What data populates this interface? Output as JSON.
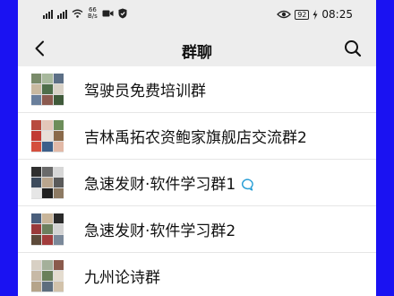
{
  "statusbar": {
    "left_text": "46",
    "speed": "66",
    "speed_unit": "B/s",
    "battery": "92",
    "time": "08:25"
  },
  "navbar": {
    "title": "群聊"
  },
  "groups": [
    {
      "name": "驾驶员免费培训群",
      "has_badge": false,
      "avatar_colors": [
        "#7a8b6a",
        "#a7b89c",
        "#5c6f86",
        "#c9b9a0",
        "#4e6e4a",
        "#d9d2c7",
        "#6a7f9b",
        "#8b5a4f",
        "#3f5a3a"
      ]
    },
    {
      "name": "吉林禹拓农资鲍家旗舰店交流群2",
      "has_badge": false,
      "avatar_colors": [
        "#b84b3f",
        "#e3c6b9",
        "#6d8d5a",
        "#c23a33",
        "#e8e0d8",
        "#8a6a4a",
        "#d44f3e",
        "#3c5f8a",
        "#e2b9a7"
      ]
    },
    {
      "name": "急速发财·软件学习群1",
      "has_badge": true,
      "avatar_colors": [
        "#2f2f2f",
        "#6a6a6a",
        "#d7d7d7",
        "#3d4b5c",
        "#b9a58e",
        "#5a5a5a",
        "#e6e6e6",
        "#1f1f1f",
        "#8d7a63"
      ]
    },
    {
      "name": "急速发财·软件学习群2",
      "has_badge": false,
      "avatar_colors": [
        "#4a5f7c",
        "#c8b59a",
        "#2a2a2a",
        "#9a3a3a",
        "#6c7f5e",
        "#d3d3d3",
        "#5d4a3a",
        "#a23c3c",
        "#7a8899"
      ]
    },
    {
      "name": "九州论诗群",
      "has_badge": false,
      "avatar_colors": [
        "#d8d0c4",
        "#a4b09a",
        "#8a5a4c",
        "#c7b9a6",
        "#6a7f5a",
        "#e4dccf",
        "#b5a48a",
        "#5e6e7e",
        "#d2c2aa"
      ]
    }
  ]
}
